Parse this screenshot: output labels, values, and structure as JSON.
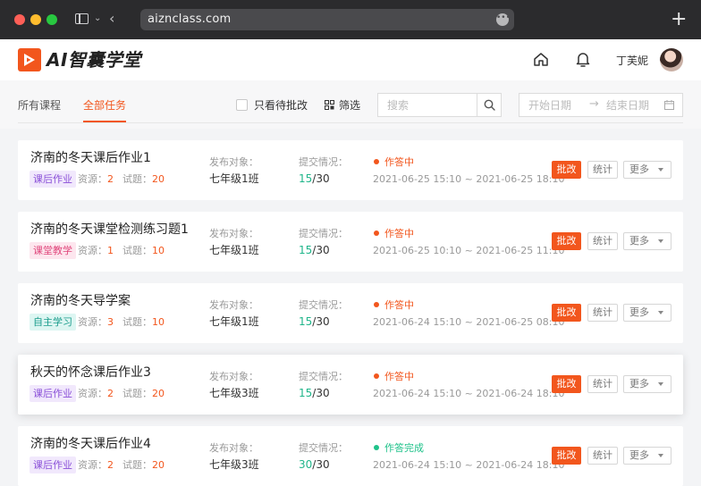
{
  "browser": {
    "url": "aiznclass.com",
    "url_more_glyph": "•••",
    "new_tab_glyph": "+",
    "chevron_down": "⌄",
    "chevron_back": "‹"
  },
  "header": {
    "logo_text": "AI智囊学堂",
    "username": "丁芙妮",
    "brand_color": "#f2561d"
  },
  "tabs": [
    {
      "label": "所有课程",
      "active": false
    },
    {
      "label": "全部任务",
      "active": true
    }
  ],
  "filters": {
    "pending_only_label": "只看待批改",
    "pending_only_checked": false,
    "filter_label": "筛选",
    "search_placeholder": "搜索",
    "date_start_placeholder": "开始日期",
    "date_arrow": "→",
    "date_end_placeholder": "结束日期"
  },
  "labels": {
    "target": "发布对象：",
    "submit": "提交情况：",
    "resources": "资源：",
    "questions": "试题：",
    "grade_button": "批改",
    "stats_button": "统计",
    "more_button": "更多"
  },
  "tasks": [
    {
      "title": "济南的冬天课后作业1",
      "tag": "课后作业",
      "tag_color": "#8a4fd8",
      "tag_bg": "#f1e8fc",
      "resources": "2",
      "questions": "20",
      "target": "七年级1班",
      "submitted": "15",
      "total": "/30",
      "status": "作答中",
      "status_color": "#f2561d",
      "time": "2021-06-25 15:10 ~ 2021-06-25 18:10"
    },
    {
      "title": "济南的冬天课堂检测练习题1",
      "tag": "课堂教学",
      "tag_color": "#e0457b",
      "tag_bg": "#fde6ee",
      "resources": "1",
      "questions": "10",
      "target": "七年级1班",
      "submitted": "15",
      "total": "/30",
      "status": "作答中",
      "status_color": "#f2561d",
      "time": "2021-06-25 10:10 ~ 2021-06-25 11:10"
    },
    {
      "title": "济南的冬天导学案",
      "tag": "自主学习",
      "tag_color": "#1a9c8c",
      "tag_bg": "#ddf6f2",
      "resources": "3",
      "questions": "10",
      "target": "七年级1班",
      "submitted": "15",
      "total": "/30",
      "status": "作答中",
      "status_color": "#f2561d",
      "time": "2021-06-24 15:10 ~ 2021-06-25 08:10"
    },
    {
      "title": "秋天的怀念课后作业3",
      "tag": "课后作业",
      "tag_color": "#8a4fd8",
      "tag_bg": "#f1e8fc",
      "resources": "2",
      "questions": "20",
      "target": "七年级3班",
      "submitted": "15",
      "total": "/30",
      "status": "作答中",
      "status_color": "#f2561d",
      "time": "2021-06-24 15:10 ~ 2021-06-24 18:10"
    },
    {
      "title": "济南的冬天课后作业4",
      "tag": "课后作业",
      "tag_color": "#8a4fd8",
      "tag_bg": "#f1e8fc",
      "resources": "2",
      "questions": "20",
      "target": "七年级3班",
      "submitted": "30",
      "total": "/30",
      "status": "作答完成",
      "status_color": "#1fc28a",
      "time": "2021-06-24 15:10 ~ 2021-06-24 18:10"
    }
  ]
}
